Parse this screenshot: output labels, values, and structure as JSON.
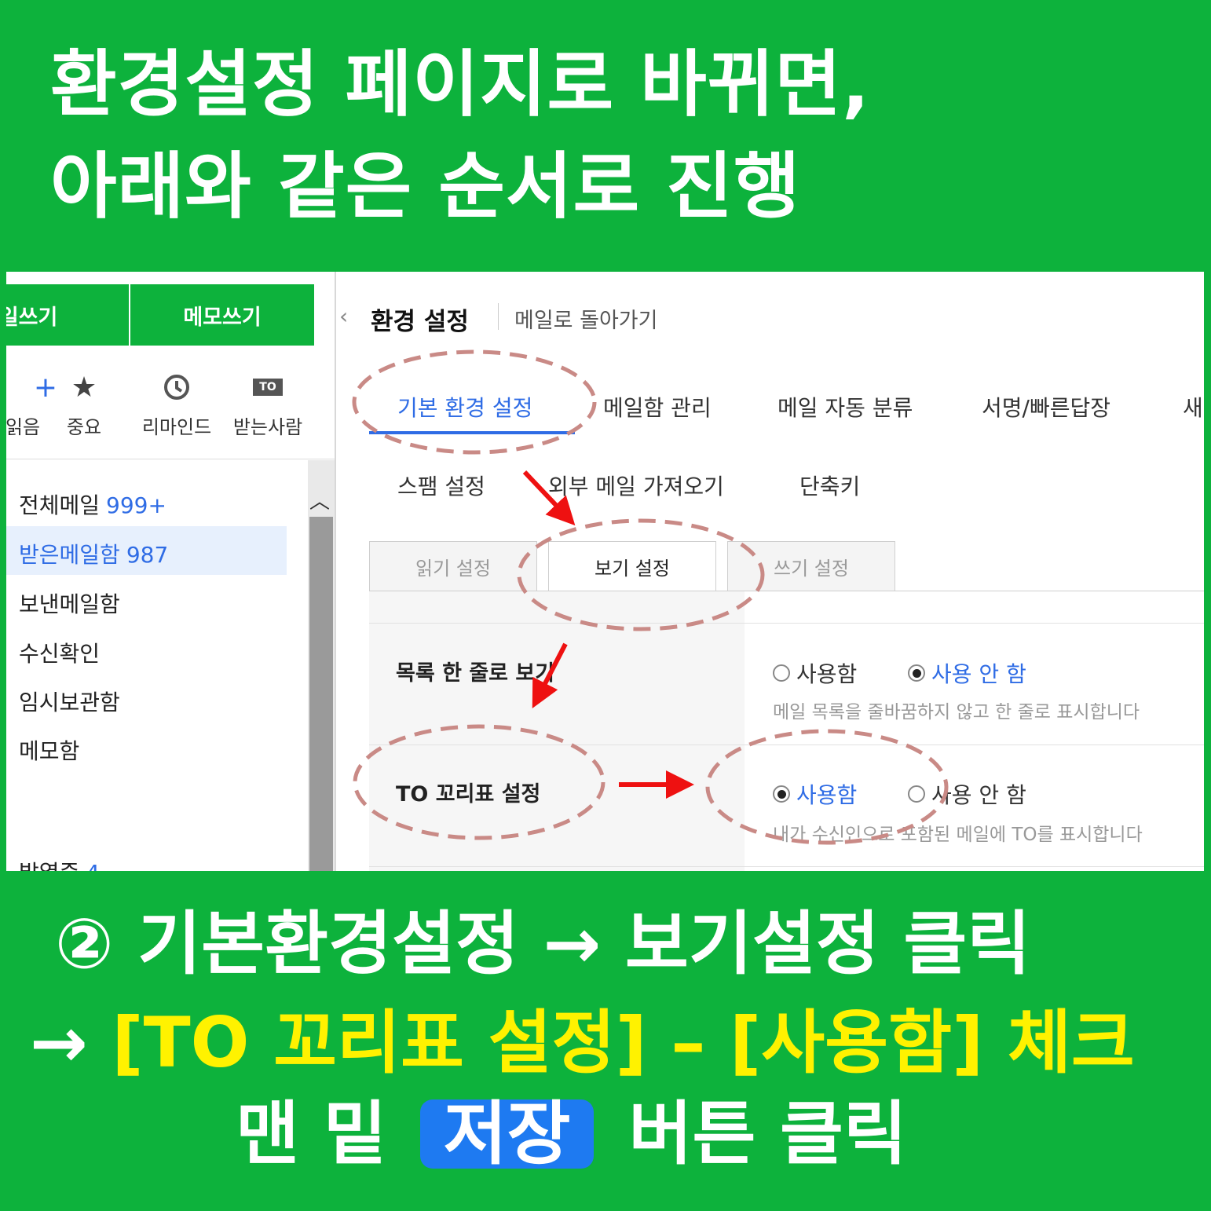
{
  "headline": {
    "line1": "환경설정 페이지로 바뀌면,",
    "line2": "아래와 같은 순서로 진행"
  },
  "sidebar": {
    "write_mail": "메일쓰기",
    "write_memo": "메모쓰기",
    "quick_filters": [
      {
        "icon": "plus-icon",
        "label": "안읽음"
      },
      {
        "icon": "star-icon",
        "label": "중요"
      },
      {
        "icon": "clock-icon",
        "label": "리마인드"
      },
      {
        "icon": "to-badge-icon",
        "badge": "TO",
        "label": "받는사람"
      }
    ],
    "folders": [
      {
        "name": "전체메일",
        "count": "999+"
      },
      {
        "name": "받은메일함",
        "count": "987",
        "selected": true
      },
      {
        "name": "보낸메일함",
        "count": ""
      },
      {
        "name": "수신확인",
        "count": ""
      },
      {
        "name": "임시보관함",
        "count": ""
      },
      {
        "name": "메모함",
        "count": ""
      },
      {
        "name": "발열중",
        "count": "4"
      }
    ]
  },
  "main": {
    "title": "환경 설정",
    "back_link": "메일로 돌아가기",
    "nav_tabs": [
      "기본 환경 설정",
      "메일함 관리",
      "메일 자동 분류",
      "서명/빠른답장",
      "새",
      "스팸 설정",
      "외부 메일 가져오기",
      "단축키"
    ],
    "sub_tabs": [
      "읽기 설정",
      "보기 설정",
      "쓰기 설정"
    ],
    "settings": [
      {
        "label": "목록 한 줄로 보기",
        "options": [
          "사용함",
          "사용 안 함"
        ],
        "selected": "사용 안 함",
        "desc": "메일 목록을 줄바꿈하지 않고 한 줄로 표시합니다"
      },
      {
        "label": "TO 꼬리표 설정",
        "options": [
          "사용함",
          "사용 안 함"
        ],
        "selected": "사용함",
        "desc": "내가 수신인으로 포함된 메일에 TO를 표시합니다"
      }
    ]
  },
  "instruction": {
    "line1": "② 기본환경설정 → 보기설정 클릭",
    "line2_arrow": "→ ",
    "line2_highlight": "[TO 꼬리표 설정] – [사용함] 체크",
    "line3_pre": "맨 밑",
    "line3_button": "저장",
    "line3_post": "버튼 클릭"
  },
  "colors": {
    "background": "#0db23c",
    "highlight_text": "#fff200",
    "save_chip": "#1e7af1",
    "link_blue": "#2f6ce5",
    "annotation_circle": "#c98a86",
    "annotation_arrow": "#ee1111"
  }
}
